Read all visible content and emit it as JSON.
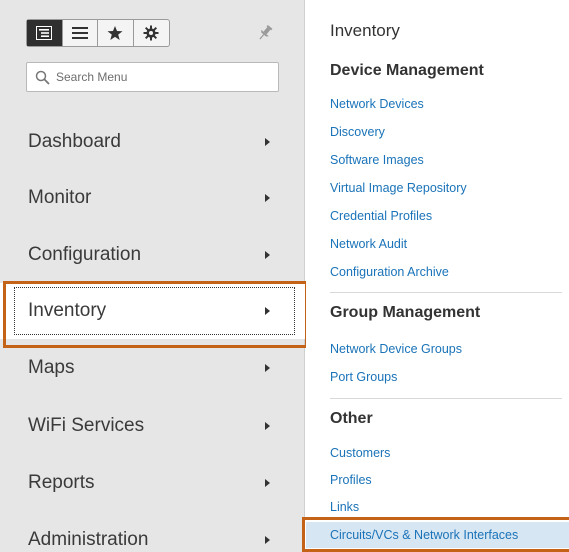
{
  "toolbar": {
    "buttons": [
      {
        "icon": "tree-list-icon",
        "active": true
      },
      {
        "icon": "list-icon",
        "active": false
      },
      {
        "icon": "star-icon",
        "active": false
      },
      {
        "icon": "gear-icon",
        "active": false
      }
    ],
    "pin_icon": "pin-icon"
  },
  "search": {
    "placeholder": "Search Menu"
  },
  "menu": {
    "items": [
      {
        "label": "Dashboard"
      },
      {
        "label": "Monitor"
      },
      {
        "label": "Configuration"
      },
      {
        "label": "Inventory"
      },
      {
        "label": "Maps"
      },
      {
        "label": "WiFi Services"
      },
      {
        "label": "Reports"
      },
      {
        "label": "Administration"
      }
    ],
    "selected": "Inventory"
  },
  "flyout": {
    "title": "Inventory",
    "sections": [
      {
        "heading": "Device Management",
        "links": [
          "Network Devices",
          "Discovery",
          "Software Images",
          "Virtual Image Repository",
          "Credential Profiles",
          "Network Audit",
          "Configuration Archive"
        ]
      },
      {
        "heading": "Group Management",
        "links": [
          "Network Device Groups",
          "Port Groups"
        ]
      },
      {
        "heading": "Other",
        "links": [
          "Customers",
          "Profiles",
          "Links",
          "Circuits/VCs & Network Interfaces"
        ]
      }
    ],
    "active_link": "Circuits/VCs & Network Interfaces"
  },
  "colors": {
    "highlight": "#c46217",
    "link": "#1a73b8",
    "panel_bg": "#e6e6e6",
    "active_link_bg": "#d7e6f3"
  }
}
